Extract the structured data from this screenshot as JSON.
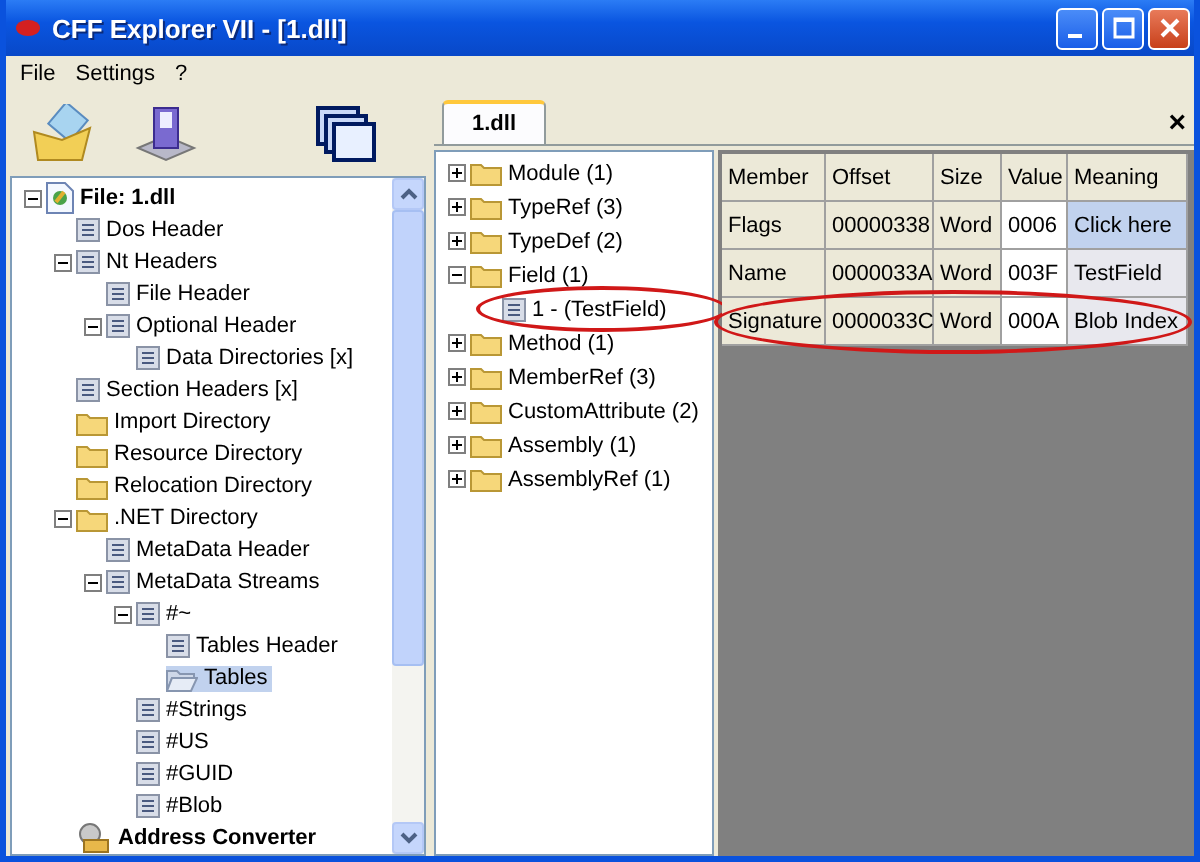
{
  "window": {
    "title": "CFF Explorer VII - [1.dll]"
  },
  "menu": [
    "File",
    "Settings",
    "?"
  ],
  "toolbar": [
    {
      "kind": "open"
    },
    {
      "kind": "save"
    },
    {
      "kind": "windows"
    }
  ],
  "left_tree": {
    "items": [
      {
        "label": "File: 1.dll",
        "kind": "file",
        "expanded": true,
        "selected": false,
        "children": [
          {
            "label": "Dos Header",
            "kind": "doc",
            "selected": false
          },
          {
            "label": "Nt Headers",
            "kind": "doc",
            "expanded": true,
            "selected": false,
            "children": [
              {
                "label": "File Header",
                "kind": "doc",
                "selected": false
              },
              {
                "label": "Optional Header",
                "kind": "doc",
                "expanded": true,
                "selected": false,
                "children": [
                  {
                    "label": "Data Directories [x]",
                    "kind": "doc",
                    "selected": false
                  }
                ]
              }
            ]
          },
          {
            "label": "Section Headers [x]",
            "kind": "doc",
            "selected": false
          },
          {
            "label": "Import Directory",
            "kind": "folder",
            "selected": false
          },
          {
            "label": "Resource Directory",
            "kind": "folder",
            "selected": false
          },
          {
            "label": "Relocation Directory",
            "kind": "folder",
            "selected": false
          },
          {
            "label": ".NET Directory",
            "kind": "folder",
            "expanded": true,
            "selected": false,
            "children": [
              {
                "label": "MetaData Header",
                "kind": "doc",
                "selected": false
              },
              {
                "label": "MetaData Streams",
                "kind": "doc",
                "expanded": true,
                "selected": false,
                "children": [
                  {
                    "label": "#~",
                    "kind": "doc",
                    "expanded": true,
                    "selected": false,
                    "children": [
                      {
                        "label": "Tables Header",
                        "kind": "doc",
                        "selected": false
                      },
                      {
                        "label": "Tables",
                        "kind": "folder-open",
                        "selected": true
                      }
                    ]
                  },
                  {
                    "label": "#Strings",
                    "kind": "doc",
                    "selected": false
                  },
                  {
                    "label": "#US",
                    "kind": "doc",
                    "selected": false
                  },
                  {
                    "label": "#GUID",
                    "kind": "doc",
                    "selected": false
                  },
                  {
                    "label": "#Blob",
                    "kind": "doc",
                    "selected": false
                  }
                ]
              }
            ]
          },
          {
            "label": "Address Converter",
            "kind": "converter",
            "selected": false
          }
        ]
      }
    ]
  },
  "tabs": [
    {
      "label": "1.dll",
      "selected": true
    }
  ],
  "close_tab": "×",
  "tables_tree": {
    "items": [
      {
        "label": "Module (1)",
        "kind": "folder",
        "expanded": false
      },
      {
        "label": "TypeRef (3)",
        "kind": "folder",
        "expanded": false
      },
      {
        "label": "TypeDef (2)",
        "kind": "folder",
        "expanded": false
      },
      {
        "label": "Field (1)",
        "kind": "folder",
        "expanded": true,
        "children": [
          {
            "label": "1 - (TestField)",
            "kind": "doc",
            "highlighted": true
          }
        ]
      },
      {
        "label": "Method (1)",
        "kind": "folder",
        "expanded": false
      },
      {
        "label": "MemberRef (3)",
        "kind": "folder",
        "expanded": false
      },
      {
        "label": "CustomAttribute (2)",
        "kind": "folder",
        "expanded": false
      },
      {
        "label": "Assembly (1)",
        "kind": "folder",
        "expanded": false
      },
      {
        "label": "AssemblyRef (1)",
        "kind": "folder",
        "expanded": false
      }
    ]
  },
  "table": {
    "columns": [
      "Member",
      "Offset",
      "Size",
      "Value",
      "Meaning"
    ],
    "rows": [
      {
        "cells": [
          "Flags",
          "00000338",
          "Word",
          "0006",
          "Click here"
        ],
        "selected": true,
        "highlighted": false
      },
      {
        "cells": [
          "Name",
          "0000033A",
          "Word",
          "003F",
          "TestField"
        ],
        "selected": false,
        "highlighted": false
      },
      {
        "cells": [
          "Signature",
          "0000033C",
          "Word",
          "000A",
          "Blob Index"
        ],
        "selected": false,
        "highlighted": true
      }
    ]
  }
}
